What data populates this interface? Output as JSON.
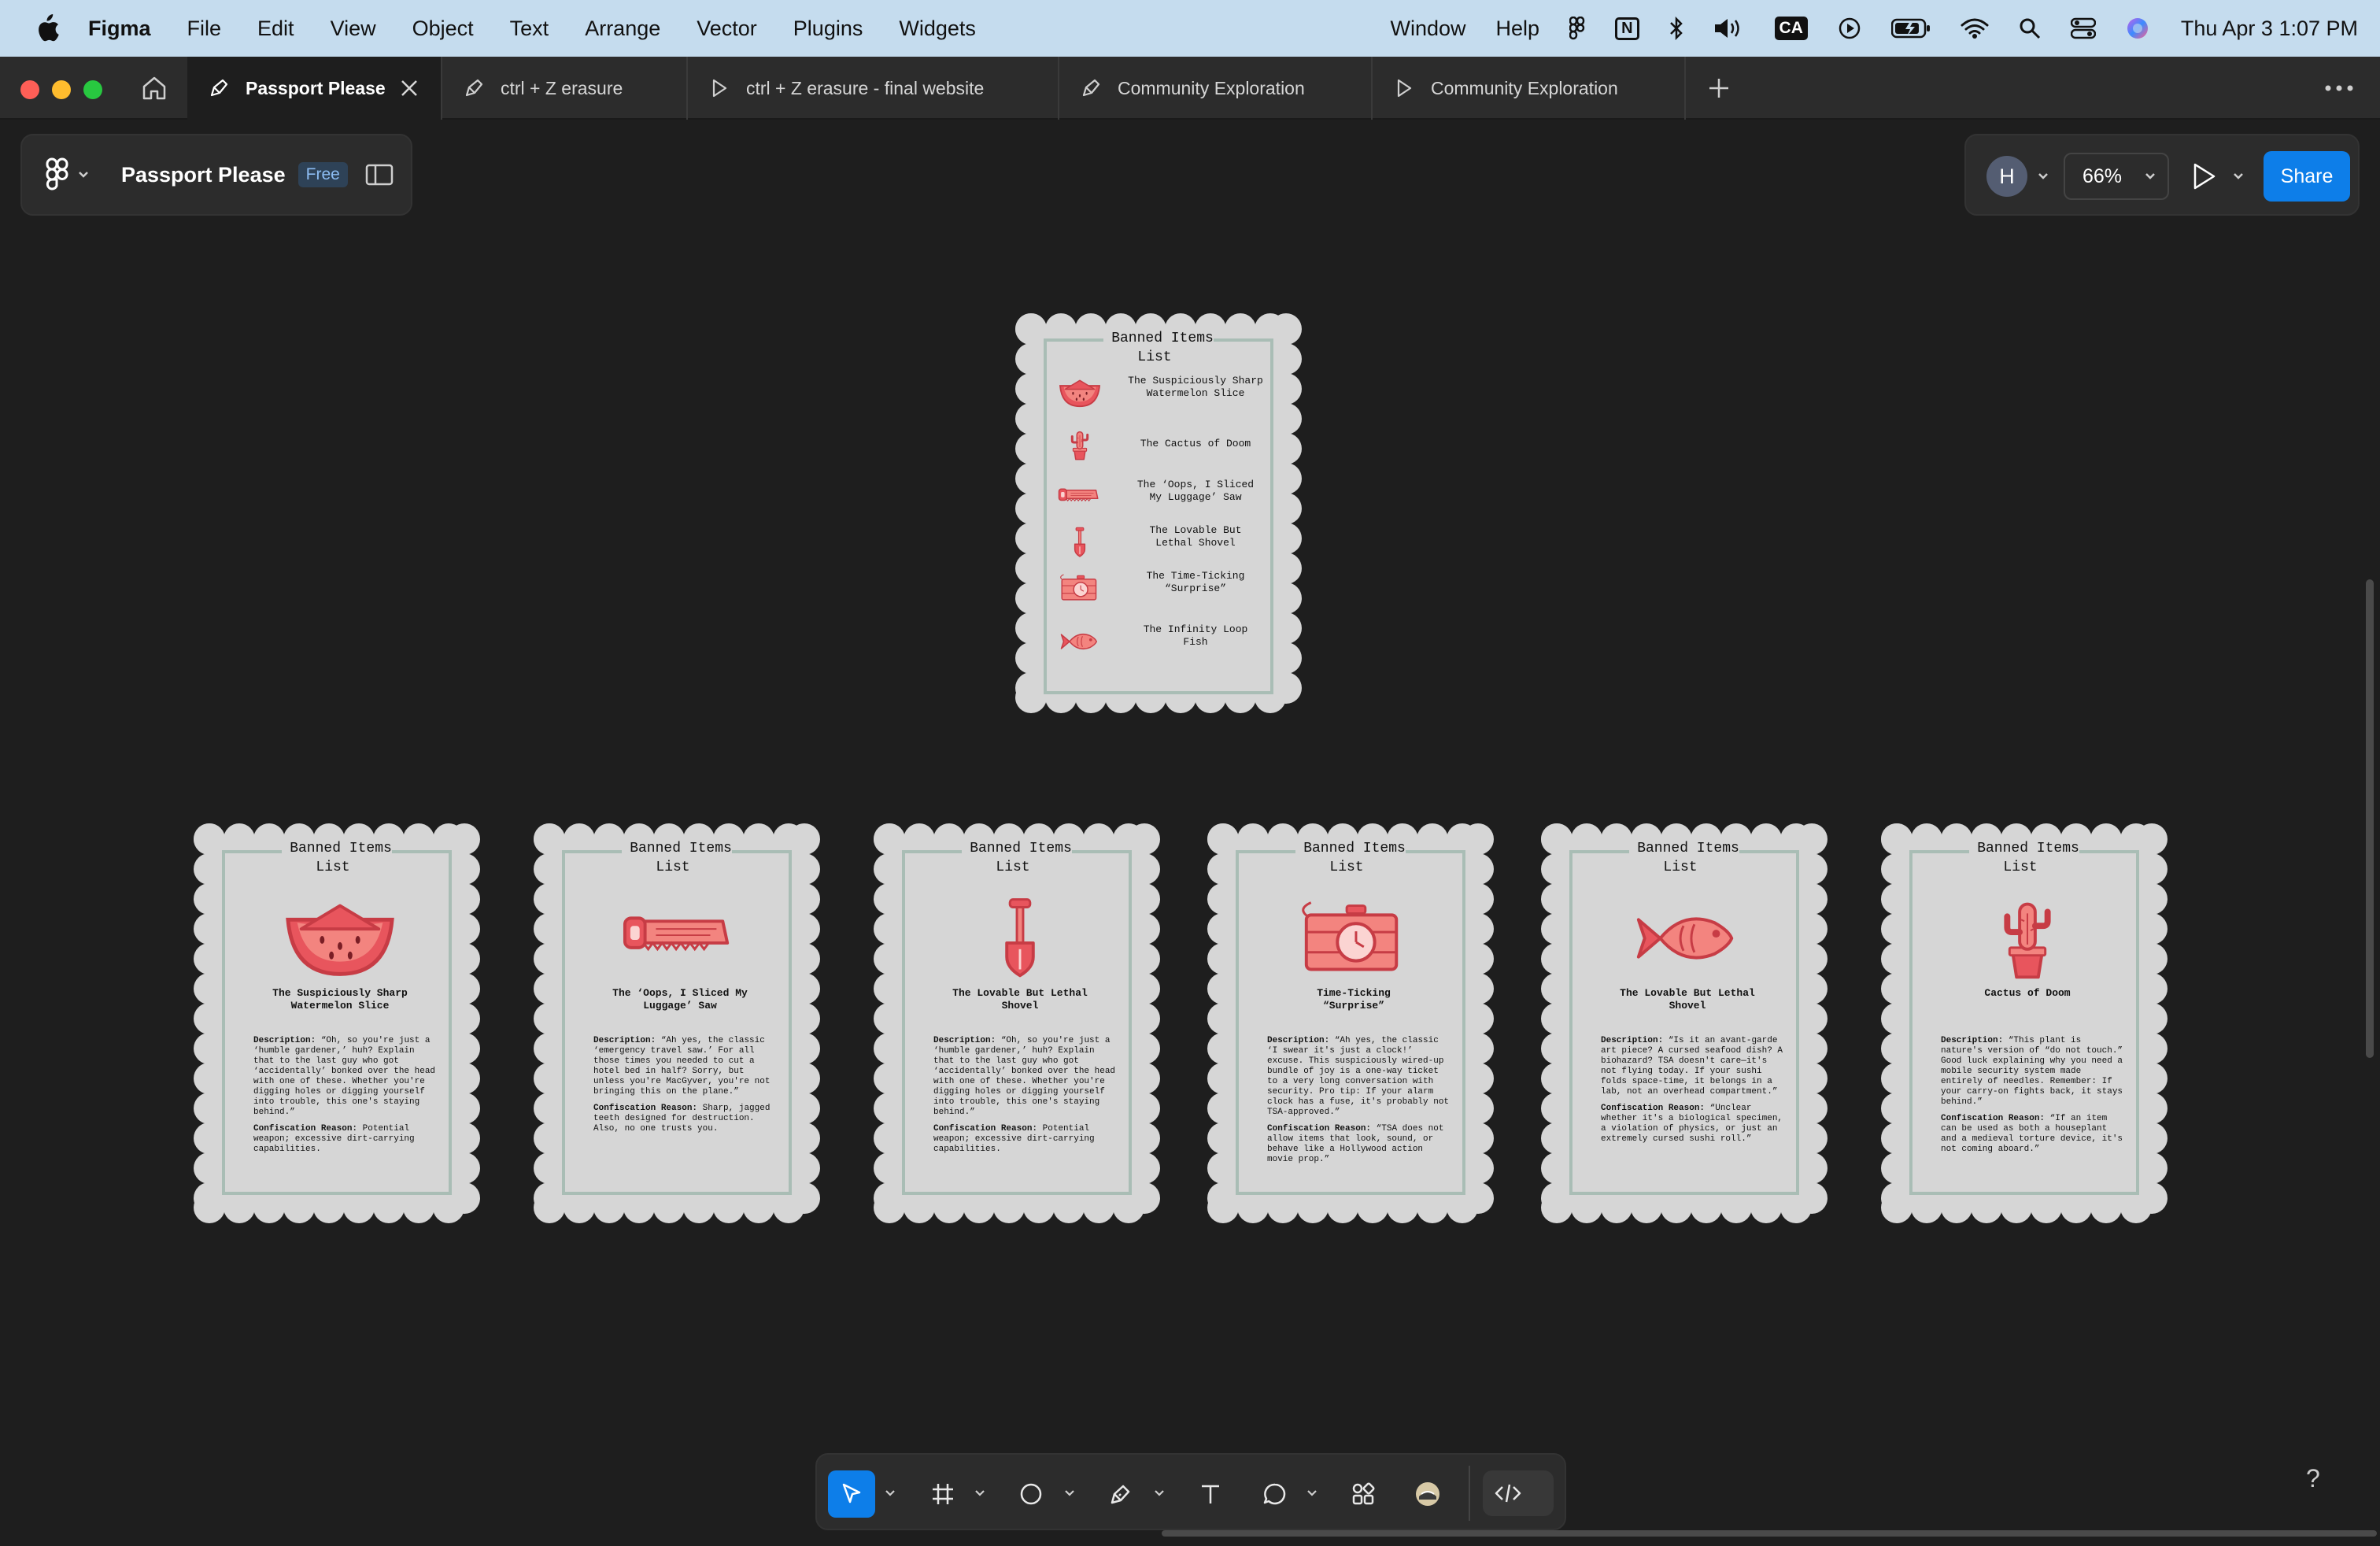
{
  "menubar": {
    "app": "Figma",
    "menus": [
      "File",
      "Edit",
      "View",
      "Object",
      "Text",
      "Arrange",
      "Vector",
      "Plugins",
      "Widgets"
    ],
    "right_menus": [
      "Window",
      "Help"
    ],
    "status_icons": [
      "figma-icon",
      "notion-icon",
      "bluetooth-icon",
      "volume-icon",
      "input-source-icon",
      "screen-record-icon",
      "battery-icon",
      "wifi-icon",
      "spotlight-icon",
      "control-center-icon",
      "siri-icon"
    ],
    "input_source": "CA",
    "notion_label": "N",
    "clock": "Thu Apr 3  1:07 PM"
  },
  "tabs": [
    {
      "label": "Passport Please",
      "active": true,
      "icon": "design-file-icon"
    },
    {
      "label": "ctrl + Z erasure",
      "active": false,
      "icon": "design-file-icon"
    },
    {
      "label": "ctrl + Z erasure - final website",
      "active": false,
      "icon": "prototype-icon"
    },
    {
      "label": "Community Exploration",
      "active": false,
      "icon": "design-file-icon"
    },
    {
      "label": "Community Exploration",
      "active": false,
      "icon": "prototype-icon"
    }
  ],
  "file": {
    "name": "Passport Please",
    "plan_badge": "Free"
  },
  "toolbar_right": {
    "avatar_initial": "H",
    "zoom": "66%",
    "share_label": "Share"
  },
  "cards": {
    "title": "Banned Items\nList",
    "list": {
      "items": [
        {
          "label": "The Suspiciously Sharp\nWatermelon Slice",
          "icon": "watermelon-icon"
        },
        {
          "label": "The Cactus of Doom",
          "icon": "cactus-icon"
        },
        {
          "label": "The ‘Oops, I Sliced\nMy Luggage’ Saw",
          "icon": "saw-icon"
        },
        {
          "label": "The Lovable But\nLethal Shovel",
          "icon": "shovel-icon"
        },
        {
          "label": "The Time-Ticking\n“Surprise”",
          "icon": "time-bomb-icon"
        },
        {
          "label": "The Infinity Loop\nFish",
          "icon": "fish-icon"
        }
      ]
    },
    "detail": [
      {
        "icon": "watermelon-icon",
        "name": "The Suspiciously Sharp\nWatermelon Slice",
        "description_label": "Description:",
        "description": "“Oh, so you're just a ‘humble gardener,’ huh? Explain that to the last guy who got ‘accidentally’ bonked over the head with one of these. Whether you're digging holes or digging yourself into trouble, this one's staying behind.”",
        "reason_label": "Confiscation Reason:",
        "reason": "Potential weapon; excessive dirt-carrying capabilities."
      },
      {
        "icon": "saw-icon",
        "name": "The ‘Oops, I Sliced My\nLuggage’ Saw",
        "description_label": "Description:",
        "description": "“Ah yes, the classic ‘emergency travel saw.’ For all those times you needed to cut a hotel bed in half? Sorry, but unless you're MacGyver, you're not bringing this on the plane.”",
        "reason_label": "Confiscation Reason:",
        "reason": "Sharp, jagged teeth designed for destruction. Also, no one trusts you."
      },
      {
        "icon": "shovel-icon",
        "name": "The Lovable But Lethal\nShovel",
        "description_label": "Description:",
        "description": "“Oh, so you're just a ‘humble gardener,’ huh? Explain that to the last guy who got ‘accidentally’ bonked over the head with one of these. Whether you're digging holes or digging yourself into trouble, this one's staying behind.”",
        "reason_label": "Confiscation Reason:",
        "reason": "Potential weapon; excessive dirt-carrying capabilities."
      },
      {
        "icon": "time-bomb-icon",
        "name": "Time-Ticking\n“Surprise”",
        "description_label": "Description:",
        "description": "“Ah yes, the classic ‘I swear it's just a clock!’ excuse. This suspiciously wired-up bundle of joy is a one-way ticket to a very long conversation with security. Pro tip: If your alarm clock has a fuse, it's probably not TSA-approved.”",
        "reason_label": "Confiscation Reason:",
        "reason": "“TSA does not allow items that look, sound, or behave like a Hollywood action movie prop.”"
      },
      {
        "icon": "fish-icon",
        "name": "The Lovable But Lethal\nShovel",
        "description_label": "Description:",
        "description": "“Is it an avant-garde art piece? A cursed seafood dish? A biohazard? TSA doesn't care—it's not flying today. If your sushi folds space-time, it belongs in a lab, not an overhead compartment.”",
        "reason_label": "Confiscation Reason:",
        "reason": "“Unclear whether it's a biological specimen, a violation of physics, or just an extremely cursed sushi roll.”"
      },
      {
        "icon": "cactus-icon",
        "name": "Cactus of Doom",
        "description_label": "Description:",
        "description": "“This plant is nature's version of “do not touch.” Good luck explaining why you need a mobile security system made entirely of needles. Remember: If your carry-on fights back, it stays behind.”",
        "reason_label": "Confiscation Reason:",
        "reason": "“If an item can be used as both a houseplant and a medieval torture device, it's not coming aboard.”"
      }
    ]
  },
  "bottom_tools": [
    "move-tool-icon",
    "frame-tool-icon",
    "shape-tool-icon",
    "pen-tool-icon",
    "text-tool-icon",
    "comment-tool-icon",
    "actions-icon",
    "plugin-avatar-icon",
    "dev-mode-icon"
  ],
  "help_label": "?",
  "colors": {
    "accent": "#0d7ee9",
    "card": "#d6d6d6",
    "frame": "#a9bdb5",
    "illustration": "#e8555d",
    "canvas": "#1e1e1e"
  }
}
